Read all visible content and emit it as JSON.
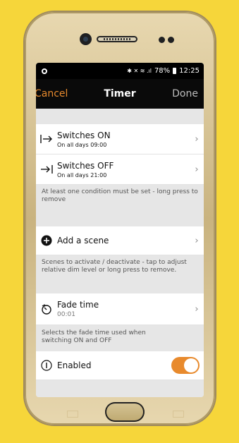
{
  "status_bar": {
    "left_icon": "notification-circle-icon",
    "icons_text": "✱ ▓✙ ≡ .▔l",
    "battery": "78%",
    "time": "12:25"
  },
  "nav": {
    "cancel": "Cancel",
    "title": "Timer",
    "done": "Done"
  },
  "switches_on": {
    "title": "Switches ON",
    "subtitle": "On all days 09:00"
  },
  "switches_off": {
    "title": "Switches OFF",
    "subtitle": "On all days 21:00"
  },
  "conditions_note": "At least one condition must be set - long press to remove",
  "add_scene": {
    "label": "Add a scene"
  },
  "scenes_note": "Scenes to activate / deactivate - tap to adjust relative dim level or long press to remove.",
  "fade_time": {
    "title": "Fade time",
    "value": "00:01"
  },
  "fade_note": "Selects the fade time used when switching ON and OFF",
  "enabled": {
    "label": "Enabled",
    "on": true
  },
  "colors": {
    "accent": "#E88A2D",
    "background": "#F6D63A"
  }
}
